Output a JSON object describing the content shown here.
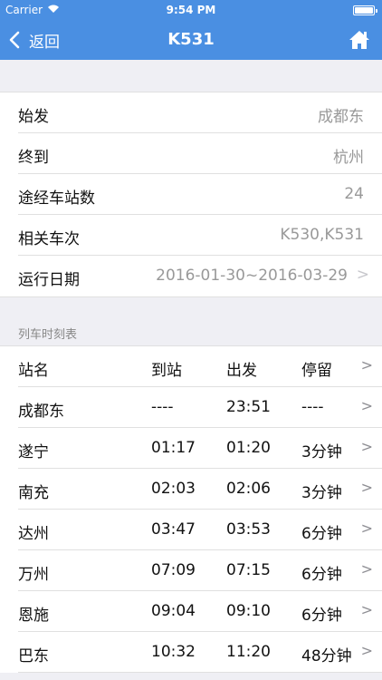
{
  "status": {
    "carrier": "Carrier",
    "time": "9:54 PM"
  },
  "nav": {
    "back_label": "返回",
    "title": "K531"
  },
  "info": [
    {
      "label": "始发",
      "value": "成都东"
    },
    {
      "label": "终到",
      "value": "杭州"
    },
    {
      "label": "途经车站数",
      "value": "24"
    },
    {
      "label": "相关车次",
      "value": "K530,K531"
    },
    {
      "label": "运行日期",
      "value": "2016-01-30~2016-03-29",
      "arrow": ">"
    }
  ],
  "timetable": {
    "section_title": "列车时刻表",
    "header": {
      "station": "站名",
      "arrive": "到站",
      "depart": "出发",
      "stay": "停留",
      "arrow": ">"
    },
    "rows": [
      {
        "station": "成都东",
        "arrive": "----",
        "depart": "23:51",
        "stay": "----",
        "arrow": ">"
      },
      {
        "station": "遂宁",
        "arrive": "01:17",
        "depart": "01:20",
        "stay": "3分钟",
        "arrow": ">"
      },
      {
        "station": "南充",
        "arrive": "02:03",
        "depart": "02:06",
        "stay": "3分钟",
        "arrow": ">"
      },
      {
        "station": "达州",
        "arrive": "03:47",
        "depart": "03:53",
        "stay": "6分钟",
        "arrow": ">"
      },
      {
        "station": "万州",
        "arrive": "07:09",
        "depart": "07:15",
        "stay": "6分钟",
        "arrow": ">"
      },
      {
        "station": "恩施",
        "arrive": "09:04",
        "depart": "09:10",
        "stay": "6分钟",
        "arrow": ">"
      },
      {
        "station": "巴东",
        "arrive": "10:32",
        "depart": "11:20",
        "stay": "48分钟",
        "arrow": ">"
      }
    ]
  }
}
